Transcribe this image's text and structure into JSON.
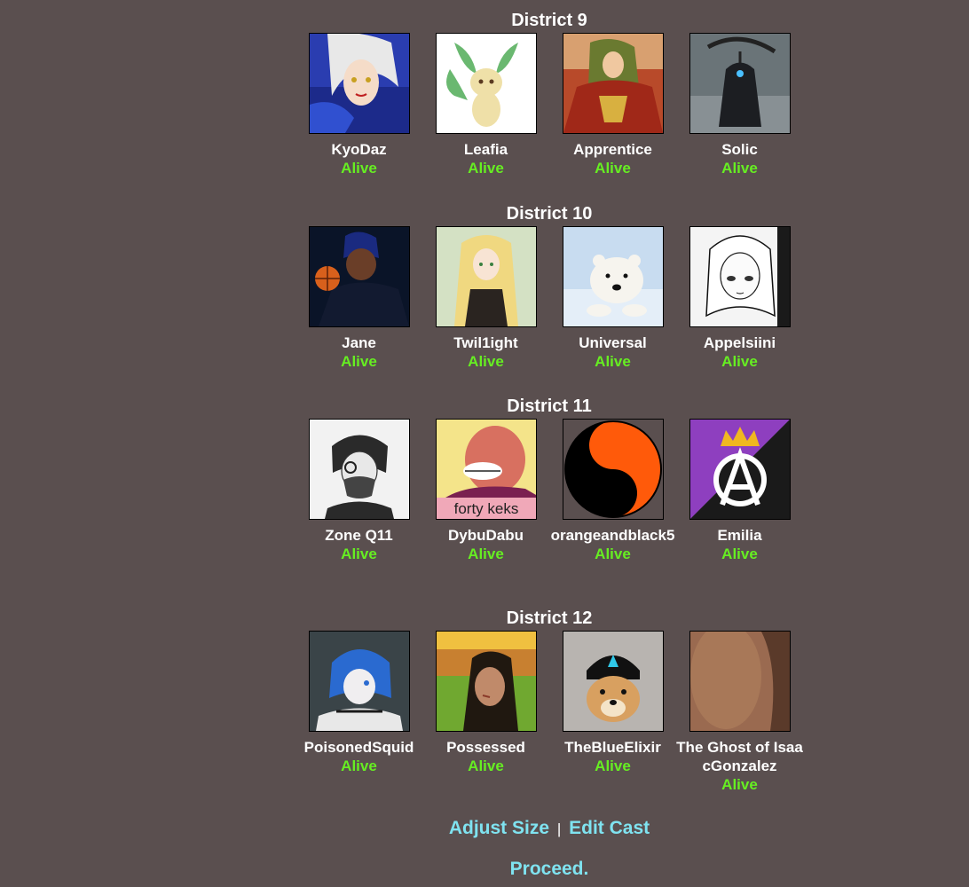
{
  "districts": [
    {
      "title": "District 9",
      "tributes": [
        {
          "name": "KyoDaz",
          "status": "Alive"
        },
        {
          "name": "Leafia",
          "status": "Alive"
        },
        {
          "name": "Apprentice",
          "status": "Alive"
        },
        {
          "name": "Solic",
          "status": "Alive"
        }
      ]
    },
    {
      "title": "District 10",
      "tributes": [
        {
          "name": "Jane",
          "status": "Alive"
        },
        {
          "name": "Twil1ight",
          "status": "Alive"
        },
        {
          "name": "Universal",
          "status": "Alive"
        },
        {
          "name": "Appelsiini",
          "status": "Alive"
        }
      ]
    },
    {
      "title": "District 11",
      "tributes": [
        {
          "name": "Zone Q11",
          "status": "Alive"
        },
        {
          "name": "DybuDabu",
          "status": "Alive",
          "avatar_text": "forty keks"
        },
        {
          "name": "orangeandblack5",
          "status": "Alive"
        },
        {
          "name": "Emilia",
          "status": "Alive"
        }
      ]
    },
    {
      "title": "District 12",
      "tributes": [
        {
          "name": "PoisonedSquid",
          "status": "Alive"
        },
        {
          "name": "Possessed",
          "status": "Alive"
        },
        {
          "name": "TheBlueElixir",
          "status": "Alive"
        },
        {
          "name": "The Ghost of IsaacGonzalez",
          "status": "Alive"
        }
      ]
    }
  ],
  "controls": {
    "adjust_size": "Adjust Size",
    "separator": "|",
    "edit_cast": "Edit Cast",
    "proceed": "Proceed."
  },
  "colors": {
    "background": "#5a4f4f",
    "alive": "#66ee22",
    "link": "#7fe3f0"
  }
}
